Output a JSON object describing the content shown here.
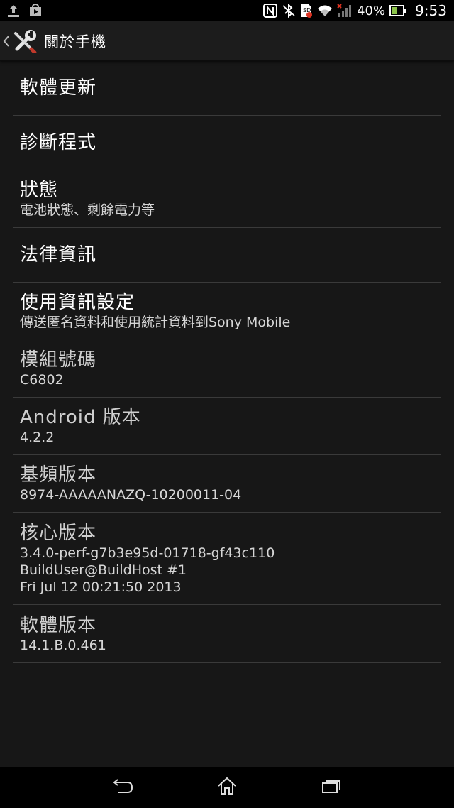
{
  "status_bar": {
    "battery_text": "40%",
    "clock": "9:53",
    "icons": [
      "upload-icon",
      "play-store-icon",
      "nfc-icon",
      "bluetooth-icon",
      "sim-error-icon",
      "wifi-icon",
      "signal-icon",
      "battery-icon"
    ]
  },
  "action_bar": {
    "title": "關於手機",
    "icon": "settings-tools-icon"
  },
  "items": [
    {
      "title": "軟體更新"
    },
    {
      "title": "診斷程式"
    },
    {
      "title": "狀態",
      "summary": "電池狀態、剩餘電力等"
    },
    {
      "title": "法律資訊"
    },
    {
      "title": "使用資訊設定",
      "summary": "傳送匿名資料和使用統計資料到Sony Mobile"
    },
    {
      "title": "模組號碼",
      "summary": "C6802"
    },
    {
      "title": "Android 版本",
      "summary": "4.2.2"
    },
    {
      "title": "基頻版本",
      "summary": "8974-AAAAANAZQ-10200011-04"
    },
    {
      "title": "核心版本",
      "summary_lines": [
        "3.4.0-perf-g7b3e95d-01718-gf43c110",
        "BuildUser@BuildHost #1",
        "Fri Jul 12 00:21:50 2013"
      ]
    },
    {
      "title": "軟體版本",
      "summary": "14.1.B.0.461"
    }
  ],
  "nav_bar": {
    "buttons": [
      "back-icon",
      "home-icon",
      "recent-apps-icon"
    ]
  }
}
